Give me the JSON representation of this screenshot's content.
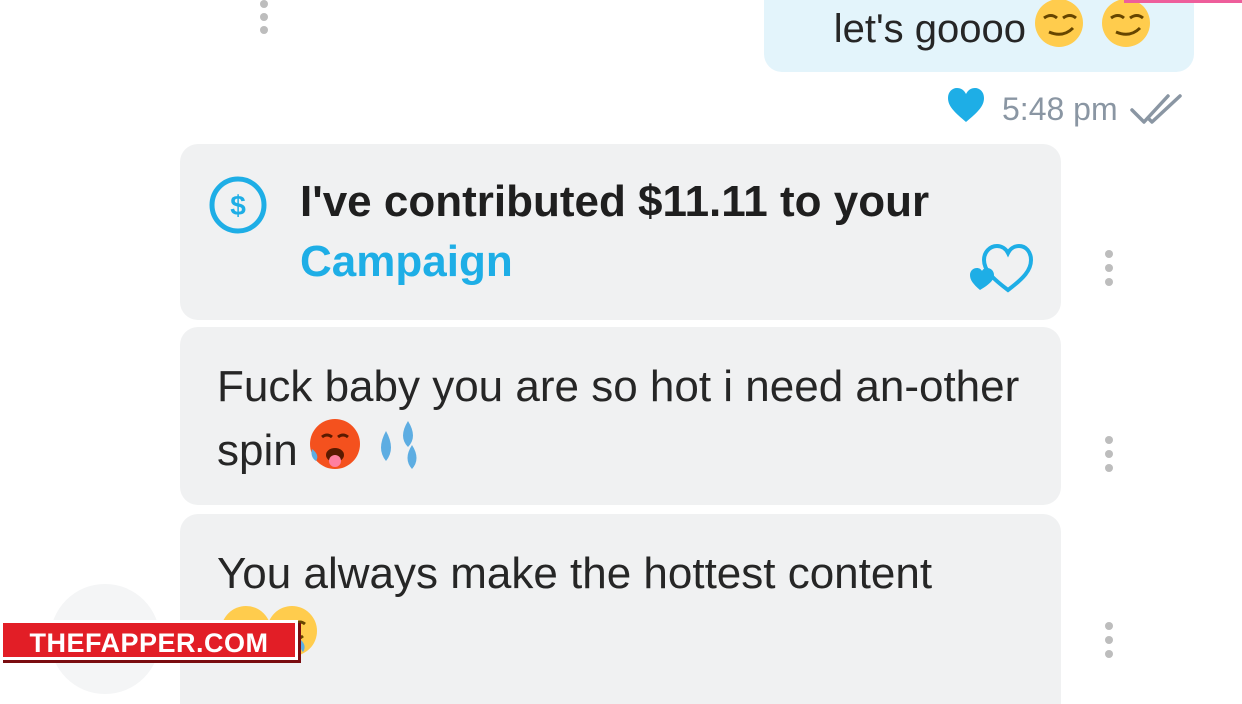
{
  "outgoing_message": {
    "text": "let's goooo",
    "emoji": [
      "smirking-face",
      "smirking-face"
    ],
    "time": "5:48 pm",
    "liked": true,
    "status": "read"
  },
  "tip_message": {
    "text_before_link": "I've contributed $11.11 to your ",
    "link_label": "Campaign",
    "amount": "$11.11",
    "icon": "dollar-circle-icon"
  },
  "messages": [
    {
      "text": "Fuck baby you are so hot i need an-other spin",
      "emoji": [
        "hot-face",
        "sweat-droplets"
      ]
    },
    {
      "text": "You always make the hottest content",
      "emoji": [
        "smiling-face",
        "drooling-face"
      ]
    }
  ],
  "watermark": "THEFAPPER.COM",
  "colors": {
    "accent": "#1eaee6",
    "incoming_bubble": "#f0f1f2",
    "outgoing_bubble": "#e3f4fb",
    "timestamp": "#8a96a3",
    "watermark": "#e21e26"
  }
}
